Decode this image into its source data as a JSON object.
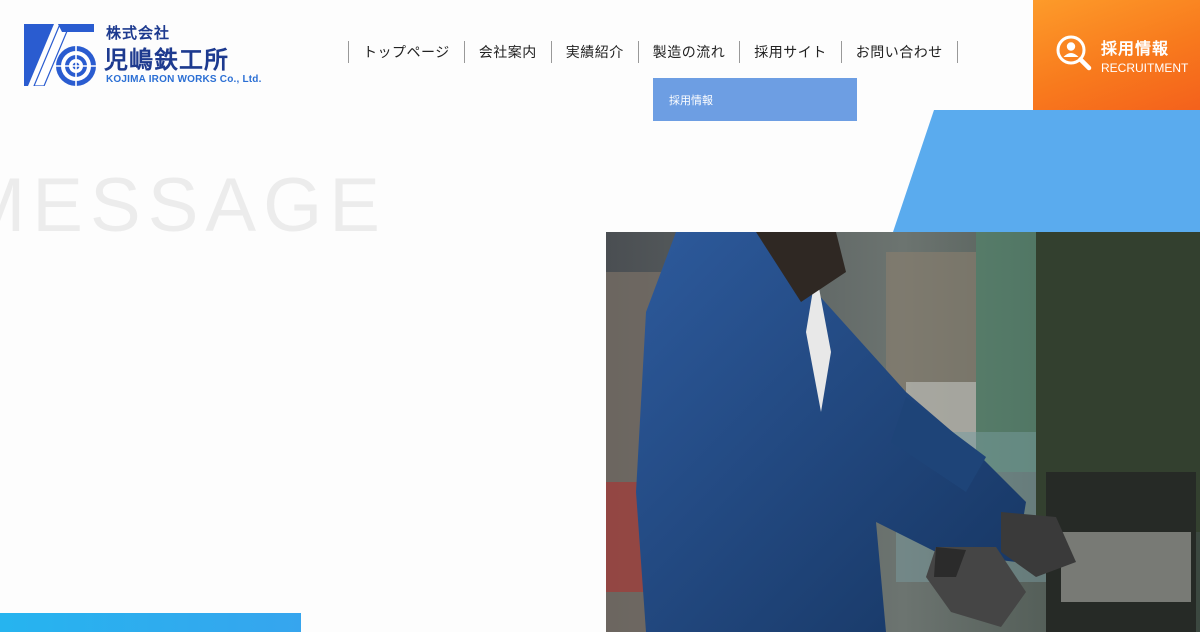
{
  "logo": {
    "company_type": "株式会社",
    "company_name": "児嶋鉄工所",
    "english_name": "KOJIMA IRON WORKS Co., Ltd."
  },
  "nav": {
    "items": [
      {
        "label": "トップページ"
      },
      {
        "label": "会社案内"
      },
      {
        "label": "実績紹介"
      },
      {
        "label": "製造の流れ"
      },
      {
        "label": "採用サイト"
      },
      {
        "label": "お問い合わせ"
      }
    ],
    "dropdown": {
      "label": "採用情報"
    }
  },
  "recruit_button": {
    "label_jp": "採用情報",
    "label_en": "RECRUITMENT",
    "icon": "user-search-icon"
  },
  "hero": {
    "watermark": "MESSAGE",
    "photo": "factory-worker-photo"
  },
  "colors": {
    "brand_blue": "#1d3a8f",
    "accent_blue": "#5aabee",
    "orange": "#f87a1d",
    "dropdown_blue": "#6d9ee3"
  }
}
